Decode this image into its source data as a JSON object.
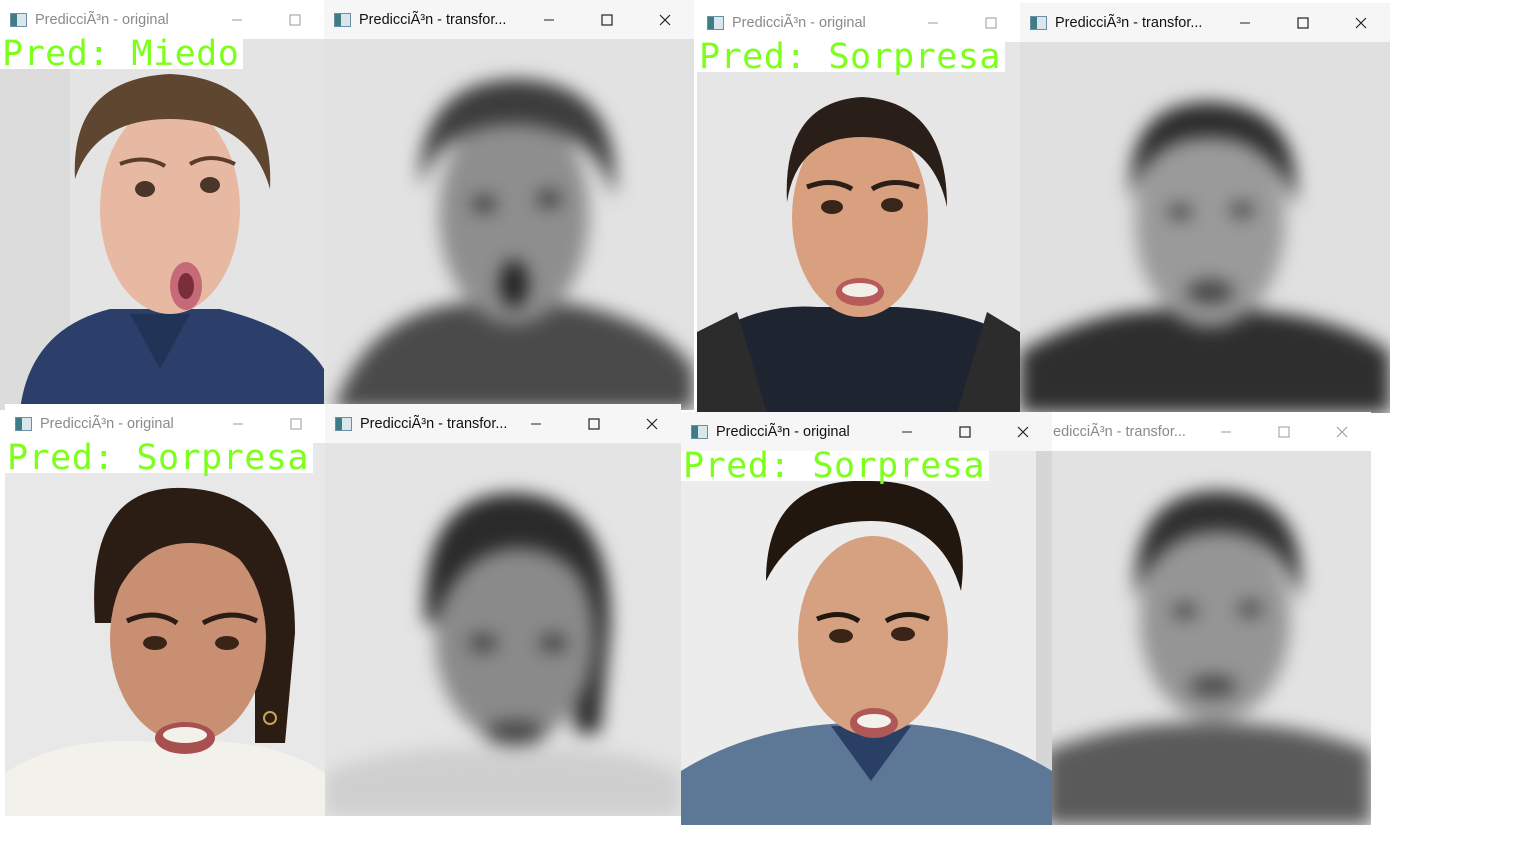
{
  "windows": [
    {
      "id": "w1",
      "title": "PredicciÃ³n - original",
      "kind": "original",
      "prediction": "Pred: Miedo",
      "active": false
    },
    {
      "id": "w2",
      "title": "PredicciÃ³n - transfor...",
      "kind": "transformed",
      "active": true
    },
    {
      "id": "w3",
      "title": "PredicciÃ³n - original",
      "kind": "original",
      "prediction": "Pred: Sorpresa",
      "active": false
    },
    {
      "id": "w4",
      "title": "PredicciÃ³n - transfor...",
      "kind": "transformed",
      "active": true
    },
    {
      "id": "w5",
      "title": "PredicciÃ³n - original",
      "kind": "original",
      "prediction": "Pred: Sorpresa",
      "active": false
    },
    {
      "id": "w6",
      "title": "PredicciÃ³n - transfor...",
      "kind": "transformed",
      "active": true
    },
    {
      "id": "w7",
      "title": "PredicciÃ³n - original",
      "kind": "original",
      "prediction": "Pred: Sorpresa",
      "active": true
    },
    {
      "id": "w8",
      "title": "edicciÃ³n - transfor...",
      "kind": "transformed",
      "active": false
    }
  ],
  "icons": {
    "minimize": "minimize-icon",
    "maximize": "maximize-icon",
    "close": "close-icon",
    "app": "app-icon"
  },
  "colors": {
    "prediction_text": "#7cff1a",
    "wall": "#e6e6e6"
  }
}
